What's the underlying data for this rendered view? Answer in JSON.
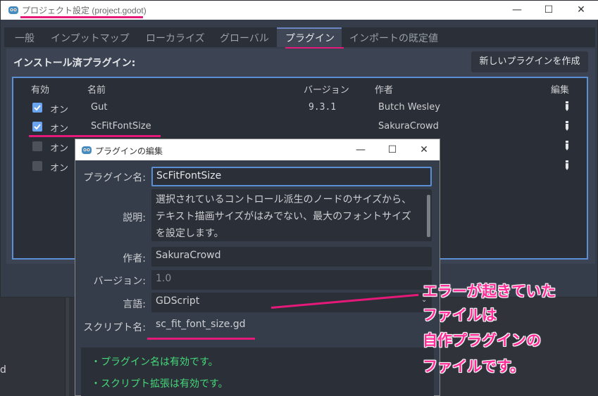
{
  "main_window": {
    "title": "プロジェクト設定 (project.godot)",
    "controls": {
      "minimize": "—",
      "maximize": "☐",
      "close": "✕"
    },
    "tabs": [
      {
        "label": "一般"
      },
      {
        "label": "インプットマップ"
      },
      {
        "label": "ローカライズ"
      },
      {
        "label": "グローバル"
      },
      {
        "label": "プラグイン",
        "active": true
      },
      {
        "label": "インポートの既定値"
      }
    ],
    "section_title": "インストール済プラグイン:",
    "new_plugin_button": "新しいプラグインを作成",
    "columns": {
      "enabled": "有効",
      "name": "名前",
      "version": "バージョン",
      "author": "作者",
      "edit": "編集"
    },
    "plugins": [
      {
        "enabled": true,
        "status": "オン",
        "name": "Gut",
        "version": "9.3.1",
        "author": "Butch Wesley"
      },
      {
        "enabled": true,
        "status": "オン",
        "name": "ScFitFontSize",
        "version": "",
        "author": "SakuraCrowd"
      },
      {
        "enabled": false,
        "status": "オン",
        "name": "",
        "version": "",
        "author": ""
      },
      {
        "enabled": false,
        "status": "オン",
        "name": "",
        "version": "",
        "author": ""
      }
    ]
  },
  "dialog": {
    "title": "プラグインの編集",
    "controls": {
      "minimize": "—",
      "maximize": "☐",
      "close": "✕"
    },
    "labels": {
      "plugin_name": "プラグイン名:",
      "description": "説明:",
      "author": "作者:",
      "version": "バージョン:",
      "language": "言語:",
      "script_name": "スクリプト名:"
    },
    "values": {
      "plugin_name": "ScFitFontSize",
      "description_lines": [
        "選択されているコントロール派生のノードのサイズから、",
        "テキスト描画サイズがはみでない、最大のフォントサイズ",
        "を設定します。"
      ],
      "author": "SakuraCrowd",
      "version": "1.0",
      "language": "GDScript",
      "script_name": "sc_fit_font_size.gd"
    },
    "status_lines": [
      "・プラグイン名は有効です。",
      "・スクリプト拡張は有効です。"
    ]
  },
  "annotation": {
    "lines": [
      "エラーが起きていた",
      "ファイルは",
      "自作プラグインの",
      "ファイルです。"
    ]
  },
  "background_fragment": "d",
  "colors": {
    "accent": "#5a8fd6",
    "highlight": "#e5197a",
    "annotation_text": "#ff2d97",
    "valid_text": "#45d97a"
  }
}
